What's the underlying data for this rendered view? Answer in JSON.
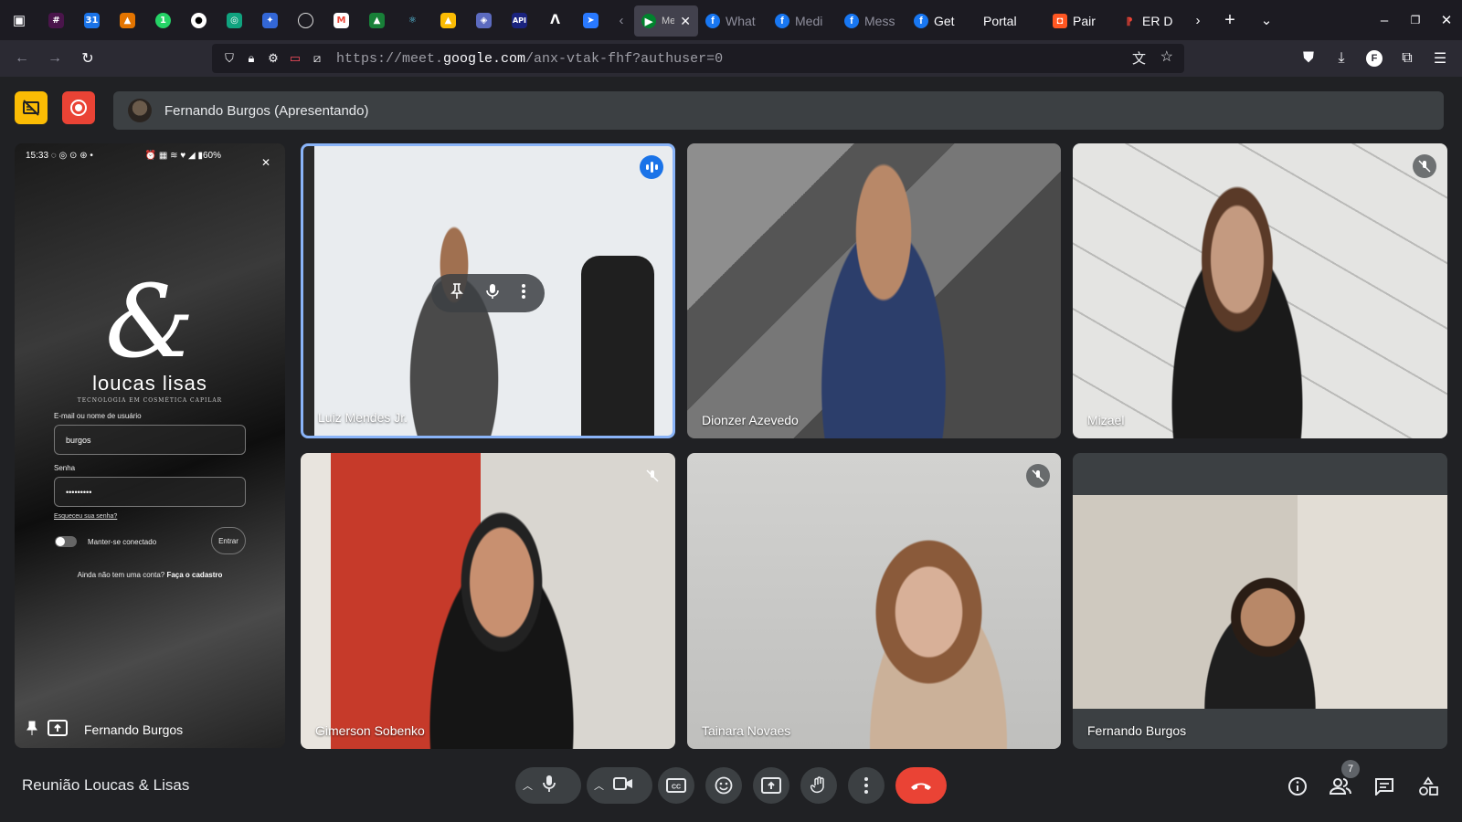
{
  "browser": {
    "tabs": [
      {
        "label": "Me PL",
        "active": true
      },
      {
        "label": "What"
      },
      {
        "label": "Medi"
      },
      {
        "label": "Mess"
      },
      {
        "label": "Get"
      },
      {
        "label": "Portal"
      },
      {
        "label": "Pair"
      },
      {
        "label": "ER D"
      }
    ],
    "url_prefix": "https://meet.",
    "url_domain": "google.com",
    "url_path": "/anx-vtak-fhf?authuser=0"
  },
  "meet": {
    "presenting_label": "Fernando Burgos (Apresentando)",
    "meeting_title": "Reunião Loucas & Lisas",
    "participant_count": "7",
    "colors": {
      "record": "#ea4335",
      "hangup": "#ea4335",
      "accent": "#1a73e8",
      "captions_badge": "#fbbc04"
    }
  },
  "phone": {
    "time": "15:33",
    "battery": "60%",
    "logo_symbol": "&",
    "brand": "loucas lisas",
    "tagline": "TECNOLOGIA EM COSMÉTICA CAPILAR",
    "user_label": "E-mail ou nome de usuário",
    "user_value": "burgos",
    "password_label": "Senha",
    "password_value": "•••••••••",
    "forgot": "Esqueceu sua senha?",
    "keep_connected": "Manter-se conectado",
    "enter": "Entrar",
    "signup_prefix": "Ainda não tem uma conta?",
    "signup_link": "Faça o cadastro",
    "presenter_name": "Fernando Burgos"
  },
  "participants": [
    {
      "name": "Luiz Mendes Jr."
    },
    {
      "name": "Dionzer Azevedo"
    },
    {
      "name": "Mizael"
    },
    {
      "name": "Gimerson Sobenko"
    },
    {
      "name": "Tainara Novaes"
    },
    {
      "name": "Fernando Burgos"
    }
  ]
}
